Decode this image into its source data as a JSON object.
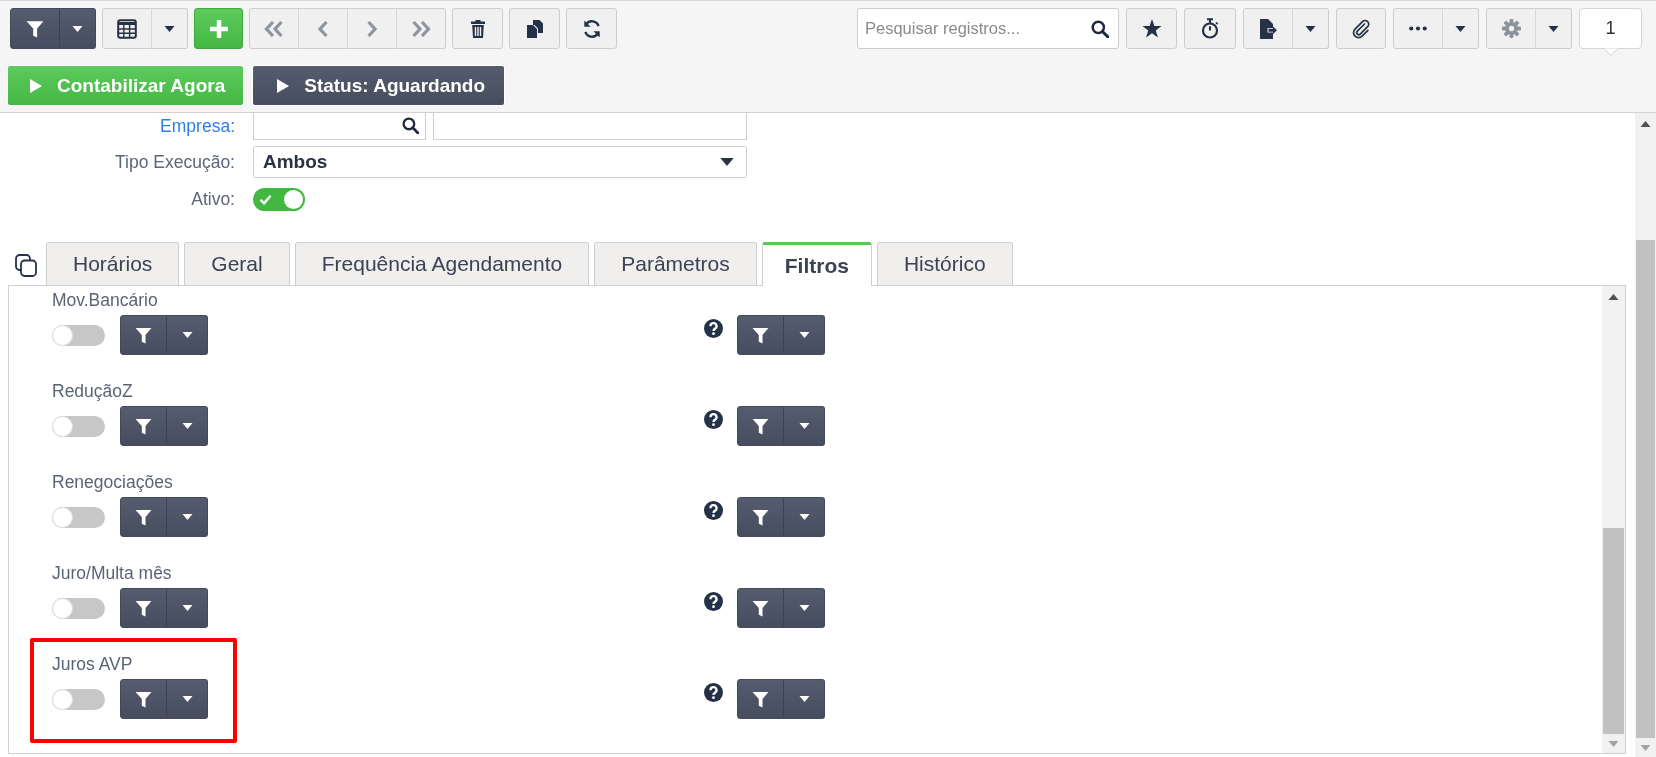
{
  "toolbar": {
    "record_navigation": {
      "disabled": true
    },
    "search": {
      "placeholder": "Pesquisar registros..."
    },
    "record_counter": "1"
  },
  "actions": [
    {
      "kind": "primary",
      "label": "Contabilizar Agora"
    },
    {
      "kind": "status",
      "label": "Status: Aguardando"
    }
  ],
  "form": {
    "fields": [
      {
        "kind": "lookup",
        "label": "Empresa:"
      },
      {
        "kind": "select",
        "label": "Tipo Execução:",
        "value": "Ambos"
      },
      {
        "kind": "toggle",
        "label": "Ativo:",
        "on": true
      }
    ]
  },
  "tabs": [
    {
      "label": "Horários",
      "selected": false
    },
    {
      "label": "Geral",
      "selected": false
    },
    {
      "label": "Frequência Agendamento",
      "selected": false
    },
    {
      "label": "Parâmetros",
      "selected": false
    },
    {
      "label": "Filtros",
      "selected": true
    },
    {
      "label": "Histórico",
      "selected": false
    }
  ],
  "filters": [
    {
      "label": "Mov.Bancário",
      "on": false,
      "highlighted": false
    },
    {
      "label": "ReduçãoZ",
      "on": false,
      "highlighted": false
    },
    {
      "label": "Renegociações",
      "on": false,
      "highlighted": false
    },
    {
      "label": "Juro/Multa mês",
      "on": false,
      "highlighted": false
    },
    {
      "label": "Juros AVP",
      "on": false,
      "highlighted": true
    }
  ]
}
